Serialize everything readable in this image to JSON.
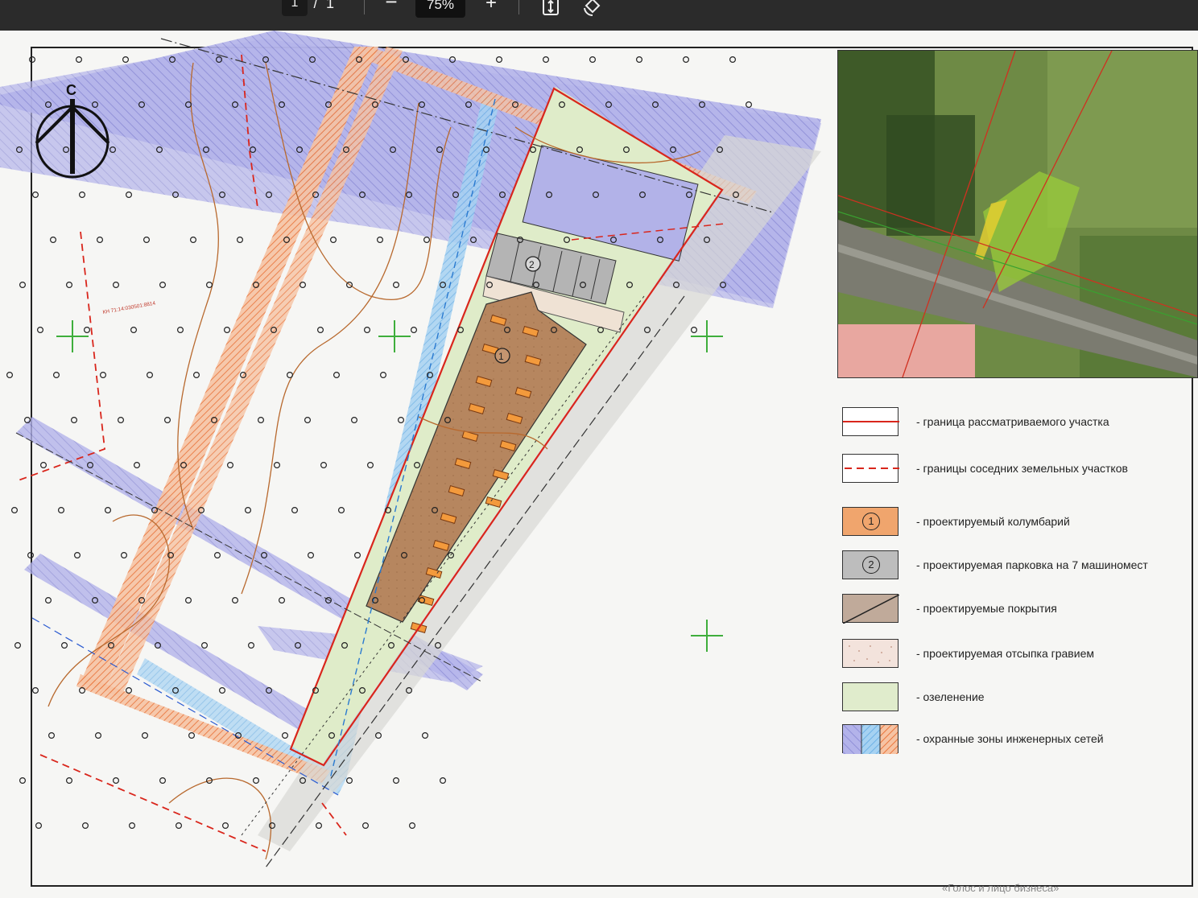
{
  "toolbar": {
    "page_current": "1",
    "page_separator": "/",
    "page_total": "1",
    "zoom_out_icon": "minus-icon",
    "zoom_level": "75%",
    "zoom_in_icon": "plus-icon",
    "fit_icon": "fit-page-icon",
    "rotate_icon": "rotate-icon"
  },
  "plan": {
    "north_label": "С",
    "cadastral_label": "КН 71:14:030501:8814",
    "object_1": "1",
    "object_2": "2"
  },
  "legend": [
    {
      "label": "- граница рассматриваемого участка",
      "swatch": "solid-red-line"
    },
    {
      "label": "- границы соседних земельных участков",
      "swatch": "dashed-red-line"
    },
    {
      "label": "- проектируемый колумбарий",
      "swatch": "orange-fill",
      "number": "1"
    },
    {
      "label": "- проектируемая парковка на  7 машиномест",
      "swatch": "grey-fill",
      "number": "2"
    },
    {
      "label": "- проектируемые покрытия",
      "swatch": "brown-diagonal"
    },
    {
      "label": "- проектируемая отсыпка гравием",
      "swatch": "dotted-pink"
    },
    {
      "label": "- озеленение",
      "swatch": "light-green"
    },
    {
      "label": "- охранные зоны инженерных сетей",
      "swatch": "hatched-blue-orange"
    }
  ],
  "colors": {
    "boundary": "#d9261c",
    "columbarium": "#b0825f",
    "parking": "#a9a9a9",
    "greening": "#e0eccc",
    "protect_zone": "#a8a8e6",
    "blue_zone": "#8cc4ee",
    "orange_zone": "#ee9a6a"
  },
  "caption": "«Голос и лицо бизнеса»"
}
